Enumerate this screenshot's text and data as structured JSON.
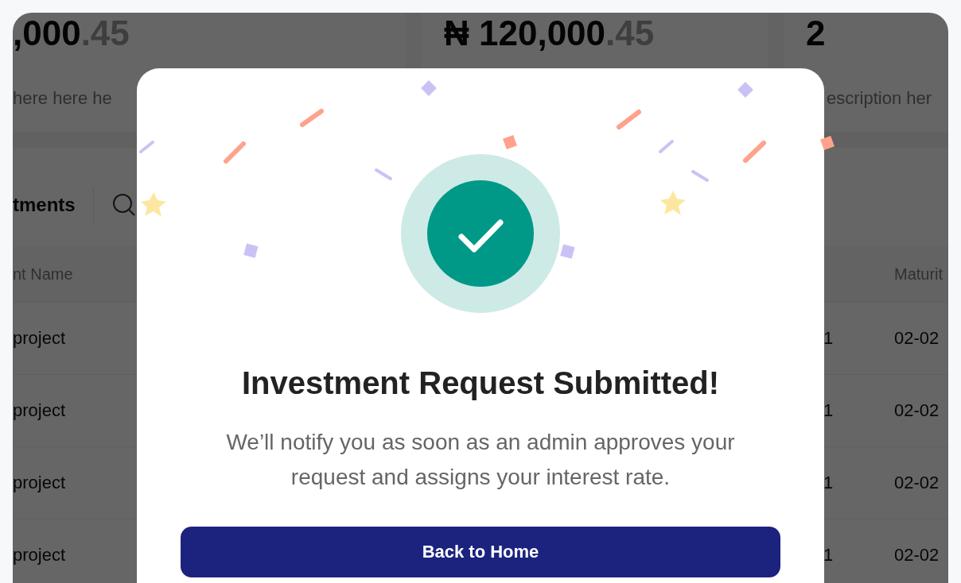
{
  "stat_cards": [
    {
      "amount": ",000",
      "decimals": ".45",
      "description": "here here he"
    },
    {
      "amount": "₦ 120,000",
      "decimals": ".45"
    },
    {
      "amount": "2",
      "description": "escription her"
    }
  ],
  "section": {
    "title": "tments"
  },
  "table": {
    "columns": [
      "nt Name",
      "Maturit"
    ],
    "rows": [
      {
        "name": "project",
        "column_2": "1",
        "maturity": "02-02"
      },
      {
        "name": "project",
        "column_2": "1",
        "maturity": "02-02"
      },
      {
        "name": "project",
        "column_2": "1",
        "maturity": "02-02"
      },
      {
        "name": "project",
        "column_2": "1",
        "maturity": "02-02"
      }
    ]
  },
  "modal": {
    "title": "Investment Request Submitted!",
    "message": "We’ll notify you as soon as an admin approves your request and assigns your interest rate.",
    "button": "Back to Home"
  }
}
